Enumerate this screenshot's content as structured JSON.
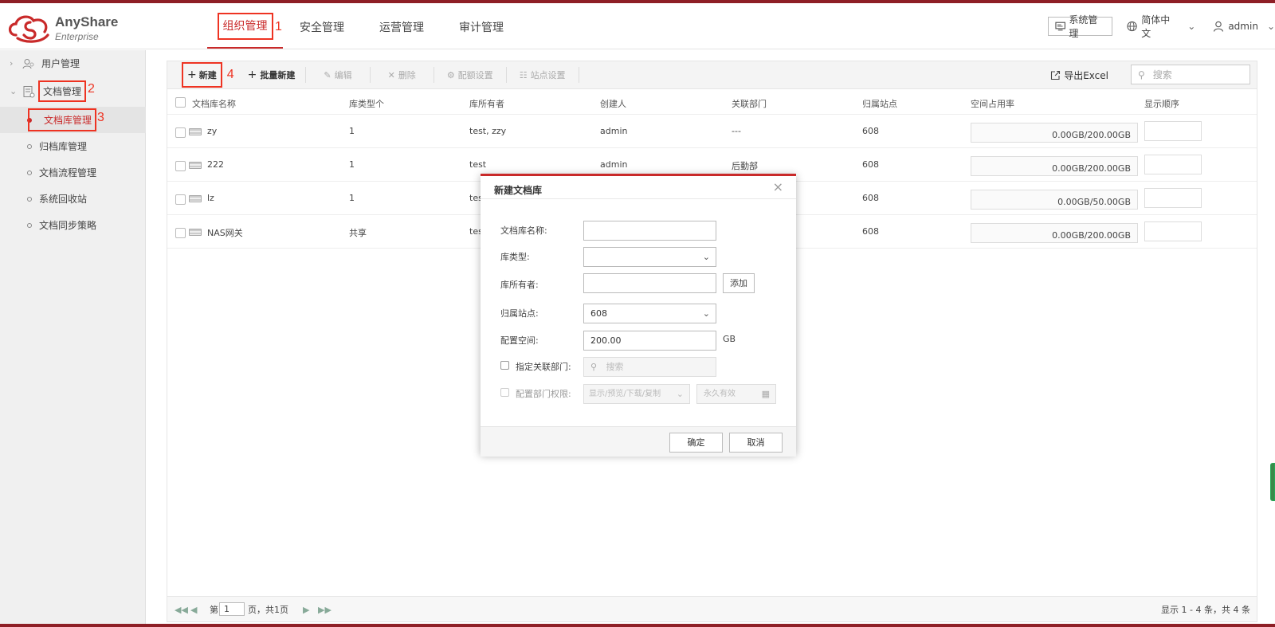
{
  "brand": {
    "name": "AnyShare",
    "edition": "Enterprise"
  },
  "nav": {
    "tabs": [
      {
        "label": "组织管理",
        "annot": "1"
      },
      {
        "label": "安全管理"
      },
      {
        "label": "运营管理"
      },
      {
        "label": "审计管理"
      }
    ]
  },
  "header_right": {
    "system_mgmt": "系统管理",
    "language": "简体中文",
    "user": "admin"
  },
  "sidebar": {
    "groups": [
      {
        "label": "用户管理"
      },
      {
        "label": "文档管理",
        "annot": "2"
      }
    ],
    "items": [
      {
        "label": "文档库管理",
        "annot": "3"
      },
      {
        "label": "归档库管理"
      },
      {
        "label": "文档流程管理"
      },
      {
        "label": "系统回收站"
      },
      {
        "label": "文档同步策略"
      }
    ]
  },
  "toolbar": {
    "new": "新建",
    "new_annot": "4",
    "batch_new": "批量新建",
    "edit": "编辑",
    "delete": "删除",
    "quota": "配额设置",
    "site": "站点设置",
    "export": "导出Excel",
    "search_placeholder": "搜索"
  },
  "table": {
    "headers": [
      "文档库名称",
      "库类型个",
      "库所有者",
      "创建人",
      "关联部门",
      "归属站点",
      "空间占用率",
      "显示顺序"
    ],
    "rows": [
      {
        "name": "zy",
        "type": "1",
        "owner": "test, zzy",
        "creator": "admin",
        "dept": "---",
        "site": "608",
        "usage": "0.00GB/200.00GB"
      },
      {
        "name": "222",
        "type": "1",
        "owner": "test",
        "creator": "admin",
        "dept": "后勤部",
        "site": "608",
        "usage": "0.00GB/200.00GB"
      },
      {
        "name": "lz",
        "type": "1",
        "owner": "tes",
        "creator": "",
        "dept": "",
        "site": "608",
        "usage": "0.00GB/50.00GB"
      },
      {
        "name": "NAS网关",
        "type": "共享",
        "owner": "tes",
        "creator": "",
        "dept": "",
        "site": "608",
        "usage": "0.00GB/200.00GB"
      }
    ]
  },
  "pager": {
    "prefix": "第",
    "page": "1",
    "suffix": "页，共1页",
    "summary": "显示 1 - 4 条，共 4 条"
  },
  "modal": {
    "title": "新建文档库",
    "fields": {
      "name_label": "文档库名称:",
      "type_label": "库类型:",
      "owner_label": "库所有者:",
      "add": "添加",
      "site_label": "归属站点:",
      "site_value": "608",
      "space_label": "配置空间:",
      "space_value": "200.00",
      "space_unit": "GB",
      "dept_label": "指定关联部门:",
      "dept_placeholder": "搜索",
      "perm_label": "配置部门权限:",
      "perm_value": "显示/预览/下载/复制",
      "expiry_value": "永久有效"
    },
    "ok": "确定",
    "cancel": "取消"
  },
  "colors": {
    "accent": "#c92a2a",
    "annotation": "#ee3322",
    "top_bar": "#8e1f26"
  }
}
